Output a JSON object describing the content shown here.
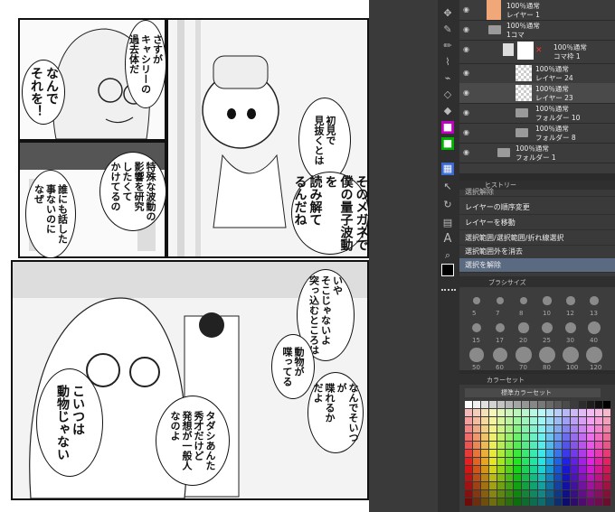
{
  "manga": {
    "bubbles": {
      "b1": "さすが\nキャシリーの\n過去体だ",
      "b2": "なんで\nそれを！",
      "b3": "初見で\n見抜くとは",
      "b4": "そのメガネで\n僕の量子波動\nを\n読み解て\nるんだね",
      "b5": "特殊な波動の\n影響を研究\nしたくて\nかけてるの",
      "b6": "誰にも話した\n事ないのに\nなぜ",
      "b7": "いや\nそこじゃないよ\n突っ込むところは",
      "b8": "動物が\n喋ってる",
      "b9": "なんでそいつ\nが\n喋れるか\nだよ",
      "b10": "こいつは\n動物じゃない",
      "b11": "タダシあんた\n秀才だけど\n発想が一般人\nなのよ"
    }
  },
  "app": {
    "layers": [
      {
        "blend": "100％通常",
        "name": "レイヤー 1",
        "kind": "layer-orange"
      },
      {
        "blend": "100％通常",
        "name": "1コマ",
        "kind": "folder"
      },
      {
        "blend": "100％通常",
        "name": "コマ枠 1",
        "kind": "frame"
      },
      {
        "blend": "100％通常",
        "name": "レイヤー 24",
        "kind": "layer"
      },
      {
        "blend": "100％通常",
        "name": "レイヤー 23",
        "kind": "layer"
      },
      {
        "blend": "100％通常",
        "name": "フォルダー 10",
        "kind": "folder"
      },
      {
        "blend": "100％通常",
        "name": "フォルダー 8",
        "kind": "folder"
      },
      {
        "blend": "100％通常",
        "name": "フォルダー 1",
        "kind": "folder"
      }
    ],
    "history": {
      "title": "ヒストリー",
      "items": [
        "選択解除",
        "レイヤーの順序変更",
        "レイヤーを移動",
        "選択範囲/選択範囲/折れ線選択",
        "選択範囲外を消去",
        "選択を解除"
      ],
      "selected_index": 5
    },
    "brush": {
      "title": "ブラシサイズ",
      "sizes": [
        "5",
        "7",
        "8",
        "10",
        "12",
        "13",
        "15",
        "17",
        "20",
        "25",
        "30",
        "40",
        "50",
        "60",
        "70",
        "80",
        "100",
        "120"
      ]
    },
    "palette": {
      "title": "カラーセット",
      "set_name": "標準カラーセット"
    },
    "icons": [
      "move-icon",
      "pen-icon",
      "pencil-icon",
      "brush-icon",
      "airbrush-icon",
      "eraser-icon",
      "fill-icon",
      "gradient-icon",
      "figure-icon",
      "frame-icon",
      "operation-icon",
      "text-icon",
      "zoom-icon",
      "hand-icon",
      "eyedropper-icon",
      "color-icon"
    ]
  }
}
